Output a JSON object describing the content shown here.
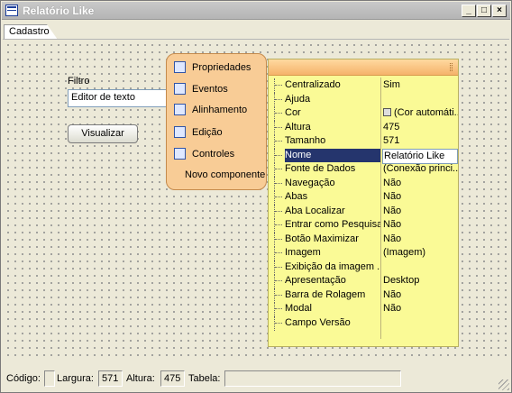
{
  "window": {
    "title": "Relatório Like",
    "minimize": "_",
    "maximize": "□",
    "close": "×"
  },
  "tabs": [
    {
      "label": "Cadastro"
    }
  ],
  "form": {
    "filter_label": "Filtro",
    "filter_value": "Editor de texto",
    "visualizar_label": "Visualizar"
  },
  "context_menu": {
    "items": [
      {
        "label": "Propriedades",
        "icon": "properties-icon"
      },
      {
        "label": "Eventos",
        "icon": "events-icon"
      },
      {
        "label": "Alinhamento",
        "icon": "alignment-icon"
      },
      {
        "label": "Edição",
        "icon": "edit-icon"
      },
      {
        "label": "Controles",
        "icon": "controls-icon"
      }
    ],
    "new_component": "Novo componente"
  },
  "properties": {
    "rows": [
      {
        "name": "Centralizado",
        "value": "Sim"
      },
      {
        "name": "Ajuda",
        "value": ""
      },
      {
        "name": "Cor",
        "value": "(Cor automáti..."
      },
      {
        "name": "Altura",
        "value": "475"
      },
      {
        "name": "Tamanho",
        "value": "571"
      },
      {
        "name": "Nome",
        "value": "Relatório Like"
      },
      {
        "name": "Fonte de Dados",
        "value": "(Conexão princi..."
      },
      {
        "name": "Navegação",
        "value": "Não"
      },
      {
        "name": "Abas",
        "value": "Não"
      },
      {
        "name": "Aba Localizar",
        "value": "Não"
      },
      {
        "name": "Entrar como Pesquisa",
        "value": "Não"
      },
      {
        "name": "Botão Maximizar",
        "value": "Não"
      },
      {
        "name": "Imagem",
        "value": "(Imagem)"
      },
      {
        "name": "Exibição da imagem ...",
        "value": ""
      },
      {
        "name": "Apresentação",
        "value": "Desktop"
      },
      {
        "name": "Barra de Rolagem",
        "value": "Não"
      },
      {
        "name": "Modal",
        "value": "Não"
      },
      {
        "name": "Campo Versão",
        "value": ""
      }
    ],
    "selected_index": 5
  },
  "status": {
    "codigo_label": "Código:",
    "codigo_value": "",
    "largura_label": "Largura:",
    "largura_value": "571",
    "altura_label": "Altura:",
    "altura_value": "475",
    "tabela_label": "Tabela:",
    "tabela_value": ""
  }
}
